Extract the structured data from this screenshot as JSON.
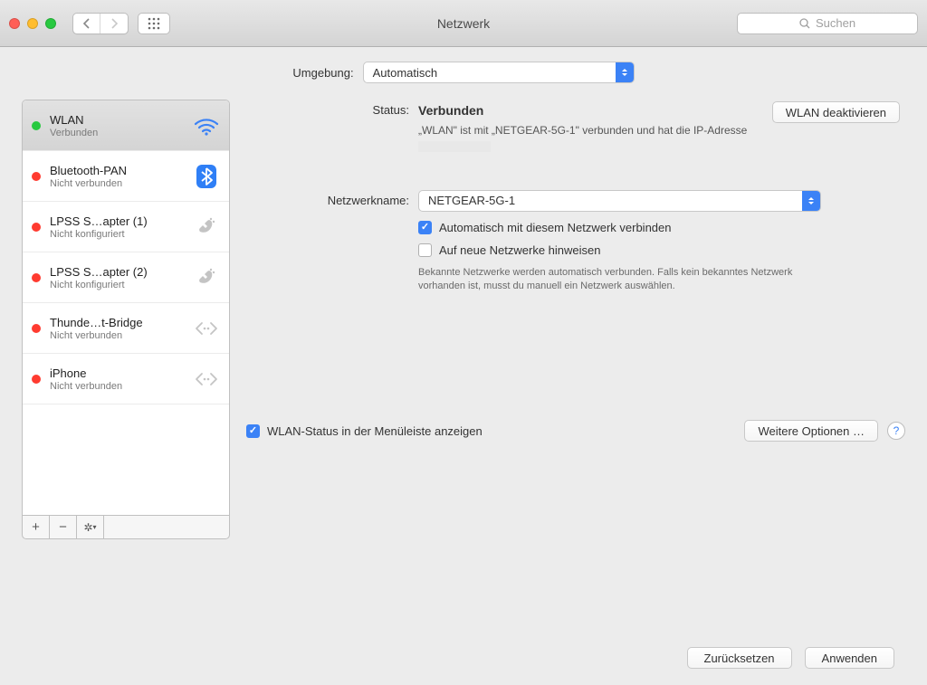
{
  "titlebar": {
    "title": "Netzwerk",
    "search_placeholder": "Suchen"
  },
  "environment": {
    "label": "Umgebung:",
    "value": "Automatisch"
  },
  "sidebar": {
    "items": [
      {
        "name": "WLAN",
        "sub": "Verbunden",
        "status_color": "#28c940",
        "icon": "wifi"
      },
      {
        "name": "Bluetooth-PAN",
        "sub": "Nicht verbunden",
        "status_color": "#ff3b30",
        "icon": "bluetooth"
      },
      {
        "name": "LPSS S…apter (1)",
        "sub": "Nicht konfiguriert",
        "status_color": "#ff3b30",
        "icon": "phone"
      },
      {
        "name": "LPSS S…apter (2)",
        "sub": "Nicht konfiguriert",
        "status_color": "#ff3b30",
        "icon": "phone"
      },
      {
        "name": "Thunde…t-Bridge",
        "sub": "Nicht verbunden",
        "status_color": "#ff3b30",
        "icon": "bridge"
      },
      {
        "name": "iPhone",
        "sub": "Nicht verbunden",
        "status_color": "#ff3b30",
        "icon": "bridge"
      }
    ]
  },
  "details": {
    "status_label": "Status:",
    "status_value": "Verbunden",
    "deactivate_label": "WLAN deaktivieren",
    "status_desc_prefix": "„WLAN\" ist mit „NETGEAR-5G-1\" verbunden und hat die IP-Adresse ",
    "network_name_label": "Netzwerkname:",
    "network_name_value": "NETGEAR-5G-1",
    "auto_connect_label": "Automatisch mit diesem Netzwerk verbinden",
    "ask_new_networks_label": "Auf neue Netzwerke hinweisen",
    "hint": "Bekannte Netzwerke werden automatisch verbunden. Falls kein bekanntes Netzwerk vorhanden ist, musst du manuell ein Netzwerk auswählen.",
    "show_menubar_label": "WLAN-Status in der Menüleiste anzeigen",
    "advanced_label": "Weitere Optionen …"
  },
  "footer": {
    "revert": "Zurücksetzen",
    "apply": "Anwenden"
  }
}
